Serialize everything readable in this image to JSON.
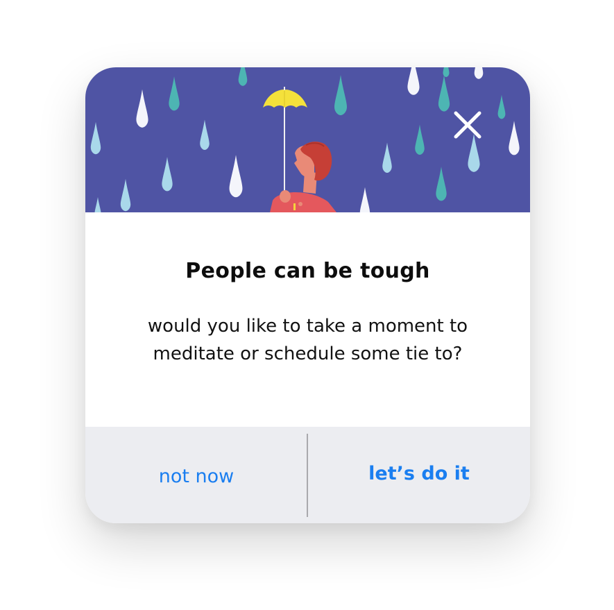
{
  "dialog": {
    "illustration": {
      "description_icon": "rain-illustration",
      "figure_icon": "person-with-umbrella-icon",
      "background_color": "#4f54a4",
      "umbrella_color": "#f5e23a",
      "figure_color": "#e0565a"
    },
    "close_icon": "close-icon",
    "title": "People can be tough",
    "message_line1": "would you like to take a moment to",
    "message_line2": "meditate or schedule some tie to?",
    "buttons": {
      "dismiss_label": "not now",
      "confirm_label": "let’s do it"
    },
    "colors": {
      "accent": "#1a7ef0",
      "actions_background": "#ecedf1"
    }
  }
}
